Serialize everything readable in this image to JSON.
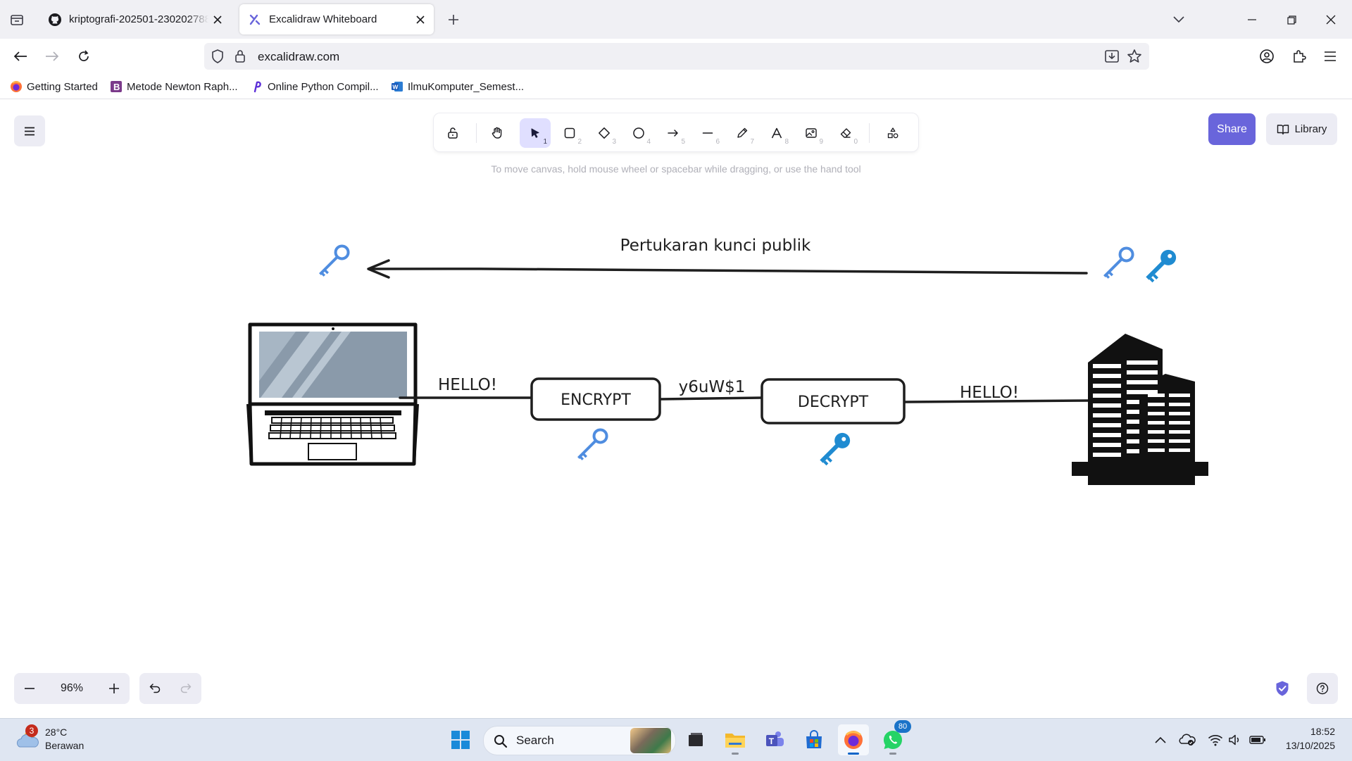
{
  "browser": {
    "tabs": [
      {
        "title": "kriptografi-202501-230202788/",
        "icon": "github-icon",
        "active": false
      },
      {
        "title": "Excalidraw Whiteboard",
        "icon": "excalidraw-icon",
        "active": true
      }
    ],
    "url": "excalidraw.com",
    "bookmarks": [
      {
        "label": "Getting Started",
        "icon": "firefox-icon"
      },
      {
        "label": "Metode Newton Raph...",
        "icon": "bookmark-b-icon"
      },
      {
        "label": "Online Python Compil...",
        "icon": "programiz-icon"
      },
      {
        "label": "IlmuKomputer_Semest...",
        "icon": "word-icon"
      }
    ]
  },
  "excalidraw": {
    "tools": [
      {
        "name": "lock",
        "key": ""
      },
      {
        "name": "hand",
        "key": ""
      },
      {
        "name": "selection",
        "key": "1",
        "active": true
      },
      {
        "name": "rectangle",
        "key": "2"
      },
      {
        "name": "diamond",
        "key": "3"
      },
      {
        "name": "ellipse",
        "key": "4"
      },
      {
        "name": "arrow",
        "key": "5"
      },
      {
        "name": "line",
        "key": "6"
      },
      {
        "name": "draw",
        "key": "7"
      },
      {
        "name": "text",
        "key": "8"
      },
      {
        "name": "image",
        "key": "9"
      },
      {
        "name": "eraser",
        "key": "0"
      },
      {
        "name": "extra-tools",
        "key": ""
      }
    ],
    "hint": "To move canvas, hold mouse wheel or spacebar while dragging, or use the hand tool",
    "share_label": "Share",
    "library_label": "Library",
    "zoom": "96%",
    "accent_color": "#6965db"
  },
  "drawing": {
    "title": "Pertukaran kunci publik",
    "plaintext_label_left": "HELLO!",
    "encrypt_label": "ENCRYPT",
    "ciphertext_label": "y6uW$1",
    "decrypt_label": "DECRYPT",
    "plaintext_label_right": "HELLO!",
    "public_key_color": "#4f8de0",
    "private_key_color": "#1f8bd1"
  },
  "taskbar": {
    "weather_temp": "28°C",
    "weather_desc": "Berawan",
    "weather_badge": "3",
    "search_label": "Search",
    "whatsapp_badge": "80",
    "time": "18:52",
    "date": "13/10/2025"
  }
}
